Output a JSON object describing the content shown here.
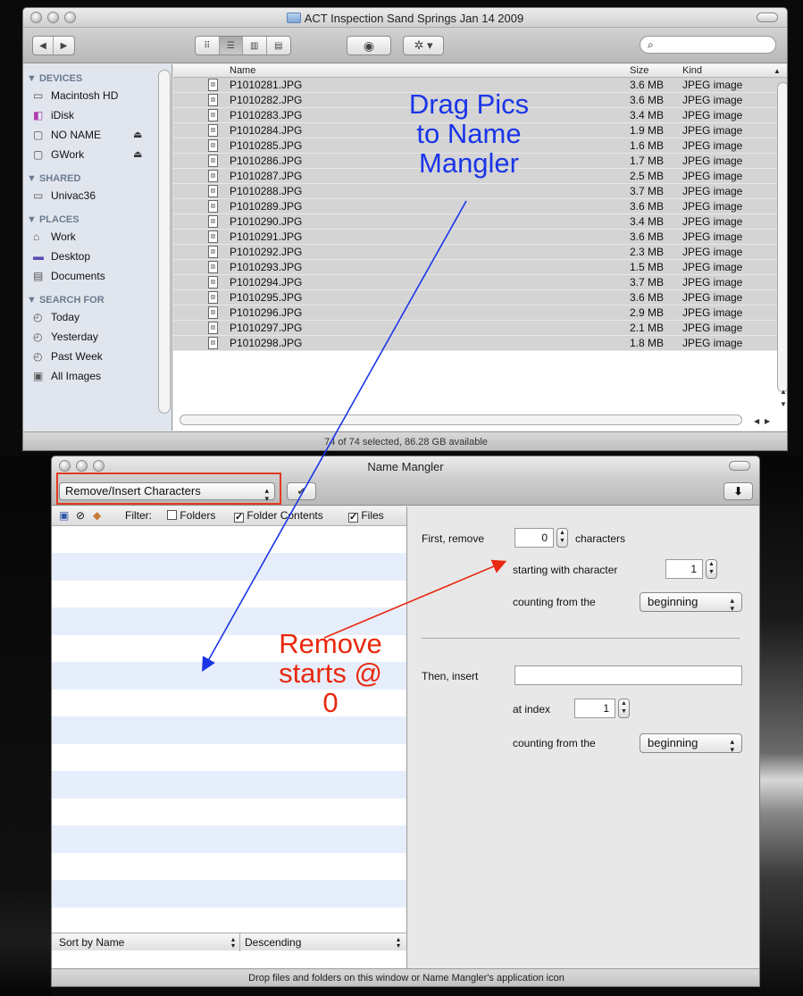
{
  "finder": {
    "title": "ACT Inspection Sand Springs Jan 14 2009",
    "search_icon": "⌕",
    "sidebar": [
      {
        "heading": "▼ DEVICES",
        "items": [
          {
            "label": "Macintosh HD",
            "icon": "hard-drive-icon"
          },
          {
            "label": "iDisk",
            "icon": "idisk-icon"
          },
          {
            "label": "NO NAME",
            "icon": "drive-icon",
            "eject": "⏏"
          },
          {
            "label": "GWork",
            "icon": "drive-icon",
            "eject": "⏏"
          }
        ]
      },
      {
        "heading": "▼ SHARED",
        "items": [
          {
            "label": "Univac36",
            "icon": "network-icon"
          }
        ]
      },
      {
        "heading": "▼ PLACES",
        "items": [
          {
            "label": "Work",
            "icon": "home-icon"
          },
          {
            "label": "Desktop",
            "icon": "desktop-icon"
          },
          {
            "label": "Documents",
            "icon": "documents-icon"
          }
        ]
      },
      {
        "heading": "▼ SEARCH FOR",
        "items": [
          {
            "label": "Today",
            "icon": "clock-icon"
          },
          {
            "label": "Yesterday",
            "icon": "clock-icon"
          },
          {
            "label": "Past Week",
            "icon": "clock-icon"
          },
          {
            "label": "All Images",
            "icon": "images-icon"
          }
        ]
      }
    ],
    "columns": {
      "name": "Name",
      "size": "Size",
      "kind": "Kind"
    },
    "files": [
      {
        "name": "P1010281.JPG",
        "size": "3.6 MB",
        "kind": "JPEG image"
      },
      {
        "name": "P1010282.JPG",
        "size": "3.6 MB",
        "kind": "JPEG image"
      },
      {
        "name": "P1010283.JPG",
        "size": "3.4 MB",
        "kind": "JPEG image"
      },
      {
        "name": "P1010284.JPG",
        "size": "1.9 MB",
        "kind": "JPEG image"
      },
      {
        "name": "P1010285.JPG",
        "size": "1.6 MB",
        "kind": "JPEG image"
      },
      {
        "name": "P1010286.JPG",
        "size": "1.7 MB",
        "kind": "JPEG image"
      },
      {
        "name": "P1010287.JPG",
        "size": "2.5 MB",
        "kind": "JPEG image"
      },
      {
        "name": "P1010288.JPG",
        "size": "3.7 MB",
        "kind": "JPEG image"
      },
      {
        "name": "P1010289.JPG",
        "size": "3.6 MB",
        "kind": "JPEG image"
      },
      {
        "name": "P1010290.JPG",
        "size": "3.4 MB",
        "kind": "JPEG image"
      },
      {
        "name": "P1010291.JPG",
        "size": "3.6 MB",
        "kind": "JPEG image"
      },
      {
        "name": "P1010292.JPG",
        "size": "2.3 MB",
        "kind": "JPEG image"
      },
      {
        "name": "P1010293.JPG",
        "size": "1.5 MB",
        "kind": "JPEG image"
      },
      {
        "name": "P1010294.JPG",
        "size": "3.7 MB",
        "kind": "JPEG image"
      },
      {
        "name": "P1010295.JPG",
        "size": "3.6 MB",
        "kind": "JPEG image"
      },
      {
        "name": "P1010296.JPG",
        "size": "2.9 MB",
        "kind": "JPEG image"
      },
      {
        "name": "P1010297.JPG",
        "size": "2.1 MB",
        "kind": "JPEG image"
      },
      {
        "name": "P1010298.JPG",
        "size": "1.8 MB",
        "kind": "JPEG image"
      }
    ],
    "status": "74 of 74 selected, 86.28 GB available"
  },
  "name_mangler": {
    "title": "Name Mangler",
    "mode_popup": "Remove/Insert Characters",
    "ok_icon": "✔",
    "download_icon": "⬇",
    "filter": {
      "label": "Filter:",
      "folders": {
        "label": "Folders",
        "checked": false
      },
      "folder_contents": {
        "label": "Folder Contents",
        "checked": true
      },
      "files": {
        "label": "Files",
        "checked": true
      }
    },
    "sort": {
      "by": "Sort by Name",
      "order": "Descending"
    },
    "remove": {
      "first_remove_label": "First, remove",
      "count": "0",
      "characters_label": "characters",
      "starting_label": "starting with character",
      "starting_value": "1",
      "counting_label": "counting from the",
      "counting_value": "beginning"
    },
    "insert": {
      "then_insert_label": "Then, insert",
      "insert_value": "",
      "at_index_label": "at index",
      "index_value": "1",
      "counting_label": "counting from the",
      "counting_value": "beginning"
    },
    "status": "Drop files and folders on this window or Name Mangler's application icon"
  },
  "annotations": {
    "blue": {
      "lines": [
        "Drag Pics",
        "to Name",
        "Mangler"
      ],
      "color": "#1a35e8"
    },
    "red": {
      "lines": [
        "Remove",
        "starts @",
        "0"
      ],
      "color": "#e8290f"
    }
  }
}
